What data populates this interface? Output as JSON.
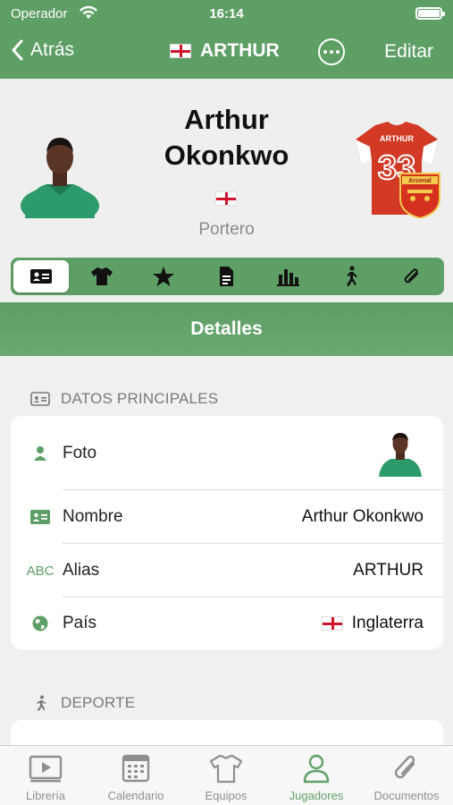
{
  "status_bar": {
    "carrier": "Operador",
    "time": "16:14"
  },
  "nav": {
    "back_label": "Atrás",
    "title": "ARTHUR",
    "edit_label": "Editar"
  },
  "player": {
    "first_name": "Arthur",
    "last_name": "Okonkwo",
    "position": "Portero",
    "shirt_number": "33",
    "shirt_name": "ARTHUR",
    "club": "Arsenal"
  },
  "tabs": [
    "id-card-icon",
    "shirt-icon",
    "star-icon",
    "document-icon",
    "stats-icon",
    "running-icon",
    "paperclip-icon"
  ],
  "section_title": "Detalles",
  "main_group": {
    "label": "DATOS PRINCIPALES",
    "rows": [
      {
        "label": "Foto",
        "icon": "person-icon"
      },
      {
        "label": "Nombre",
        "value": "Arthur Okonkwo",
        "icon": "id-card-icon"
      },
      {
        "label": "Alias",
        "value": "ARTHUR",
        "icon_text": "ABC"
      },
      {
        "label": "País",
        "value": "Inglaterra",
        "icon": "globe-icon"
      }
    ]
  },
  "sport_group": {
    "label": "DEPORTE"
  },
  "tab_bar": [
    {
      "label": "Librería",
      "active": false
    },
    {
      "label": "Calendario",
      "active": false
    },
    {
      "label": "Equipos",
      "active": false
    },
    {
      "label": "Jugadores",
      "active": true
    },
    {
      "label": "Documentos",
      "active": false
    }
  ],
  "colors": {
    "accent": "#5e9f66",
    "background": "#f0f0f0"
  }
}
